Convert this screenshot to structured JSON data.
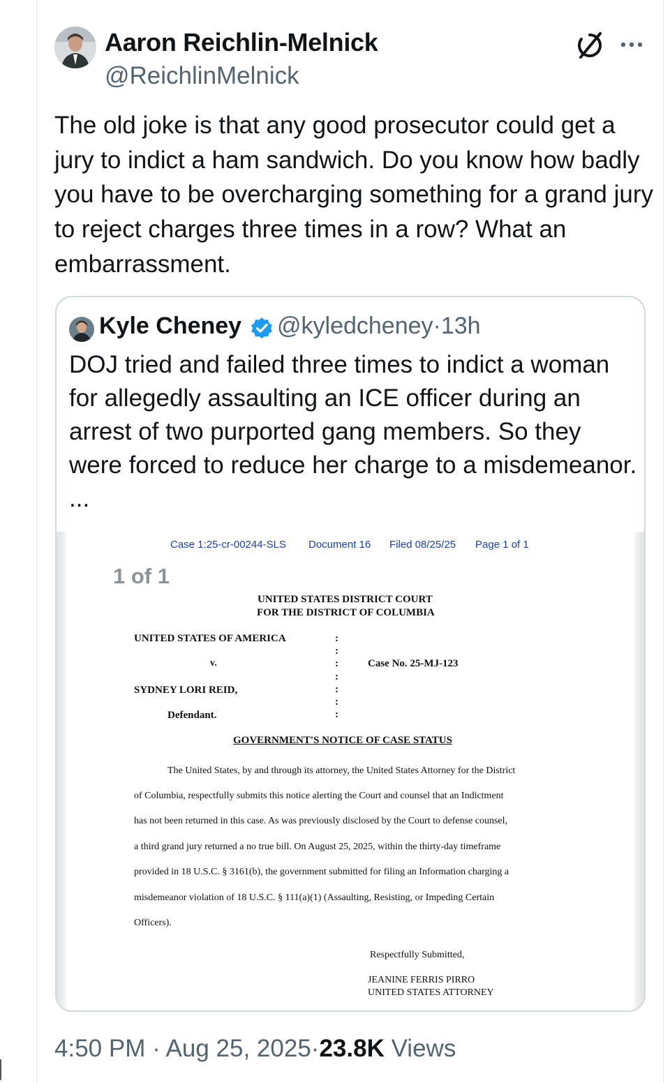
{
  "post": {
    "author_name": "Aaron Reichlin-Melnick",
    "author_handle": "@ReichlinMelnick",
    "text": "The old joke is that any good prosecutor could get a jury to indict a ham sandwich. Do you know how badly you have to be overcharging something for a grand jury to reject charges three times in a row? What an embarrassment.",
    "time": "4:50 PM",
    "date": "Aug 25, 2025",
    "views_count": "23.8K",
    "views_label": "Views",
    "separator": "·"
  },
  "quote": {
    "author_name": "Kyle Cheney",
    "author_handle": "@kyledcheney",
    "age": "13h",
    "text": "DOJ tried and failed three times to indict a woman for allegedly assaulting an ICE officer during an arrest of two purported gang members. So they were forced to reduce her charge to a misdemeanor. ...",
    "media_counter": "1 of 1"
  },
  "document": {
    "header": {
      "case": "Case 1:25-cr-00244-SLS",
      "doc": "Document 16",
      "filed": "Filed 08/25/25",
      "page": "Page 1 of 1"
    },
    "court_line1": "UNITED STATES DISTRICT COURT",
    "court_line2": "FOR THE DISTRICT OF COLUMBIA",
    "plaintiff": "UNITED STATES OF AMERICA",
    "versus": "v.",
    "case_no": "Case No. 25-MJ-123",
    "defendant_name": "SYDNEY LORI REID,",
    "defendant_label": "Defendant.",
    "colon": ":",
    "title": "GOVERNMENT'S NOTICE OF CASE STATUS",
    "body_lines": [
      "The United States, by and through its attorney, the United States Attorney for the District",
      "of Columbia, respectfully submits this notice alerting the Court and counsel that an Indictment",
      "has not been returned in this case.  As was previously disclosed by the Court to defense counsel,",
      "a third grand jury returned a no true bill.  On August 25, 2025, within the thirty-day timeframe",
      "provided in 18 U.S.C. § 3161(b), the government submitted for filing an Information charging a",
      "misdemeanor violation of 18 U.S.C. § 111(a)(1) (Assaulting, Resisting, or Impeding Certain",
      "Officers)."
    ],
    "closing": "Respectfully Submitted,",
    "signer_name": "JEANINE FERRIS PIRRO",
    "signer_title": "UNITED STATES ATTORNEY"
  },
  "icons": {
    "grok": "grok-icon",
    "more": "more-icon",
    "verified": "verified-badge-icon"
  },
  "colors": {
    "text": "#0f1419",
    "secondary": "#536471",
    "border": "#cfd9de",
    "verified": "#1d9bf0",
    "doc_header": "#1a3fb3"
  }
}
